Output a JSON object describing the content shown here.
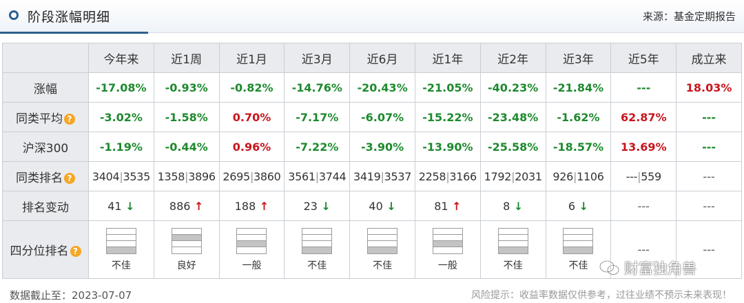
{
  "header": {
    "title": "阶段涨幅明细",
    "source": "来源：基金定期报告"
  },
  "columns": [
    "今年来",
    "近1周",
    "近1月",
    "近3月",
    "近6月",
    "近1年",
    "近2年",
    "近3年",
    "近5年",
    "成立来"
  ],
  "rows": {
    "zhangfu": {
      "label": "涨幅",
      "values": [
        "-17.08%",
        "-0.93%",
        "-0.82%",
        "-14.76%",
        "-20.43%",
        "-21.05%",
        "-40.23%",
        "-21.84%",
        "---",
        "18.03%"
      ]
    },
    "tonglei_avg": {
      "label": "同类平均",
      "values": [
        "-3.02%",
        "-1.58%",
        "0.70%",
        "-7.17%",
        "-6.07%",
        "-15.22%",
        "-23.48%",
        "-1.62%",
        "62.87%",
        "---"
      ]
    },
    "hs300": {
      "label": "沪深300",
      "values": [
        "-1.19%",
        "-0.44%",
        "0.96%",
        "-7.22%",
        "-3.90%",
        "-13.90%",
        "-25.58%",
        "-18.57%",
        "13.69%",
        "---"
      ]
    },
    "tonglei_rank": {
      "label": "同类排名",
      "values": [
        [
          "3404",
          "3535"
        ],
        [
          "1358",
          "3896"
        ],
        [
          "2695",
          "3860"
        ],
        [
          "3561",
          "3744"
        ],
        [
          "3419",
          "3537"
        ],
        [
          "2258",
          "3166"
        ],
        [
          "1792",
          "2031"
        ],
        [
          "926",
          "1106"
        ],
        [
          "---",
          "559"
        ],
        "---"
      ]
    },
    "rank_change": {
      "label": "排名变动",
      "values": [
        [
          "41",
          "down"
        ],
        [
          "886",
          "up"
        ],
        [
          "188",
          "up"
        ],
        [
          "23",
          "down"
        ],
        [
          "40",
          "down"
        ],
        [
          "81",
          "up"
        ],
        [
          "8",
          "down"
        ],
        [
          "6",
          "down"
        ],
        "---",
        "---"
      ]
    },
    "quartile": {
      "label": "四分位排名",
      "values": [
        [
          "不佳",
          4
        ],
        [
          "良好",
          2
        ],
        [
          "一般",
          3
        ],
        [
          "不佳",
          4
        ],
        [
          "不佳",
          4
        ],
        [
          "一般",
          3
        ],
        [
          "不佳",
          4
        ],
        [
          "不佳",
          4
        ],
        "---",
        "---"
      ]
    }
  },
  "icons": {
    "help": "question-circle-icon",
    "arrow_up": "↑",
    "arrow_down": "↓"
  },
  "colors": {
    "negative": "#1d8a2e",
    "positive": "#c8161d",
    "accent": "#2d5f8d",
    "help_icon": "#f5a623"
  },
  "footer": {
    "date_label": "数据截止至：2023-07-07",
    "disclaimer": "风险提示：收益率数据仅供参考，过往业绩不预示未来表现！"
  },
  "watermark": {
    "text": "财富独角兽"
  }
}
